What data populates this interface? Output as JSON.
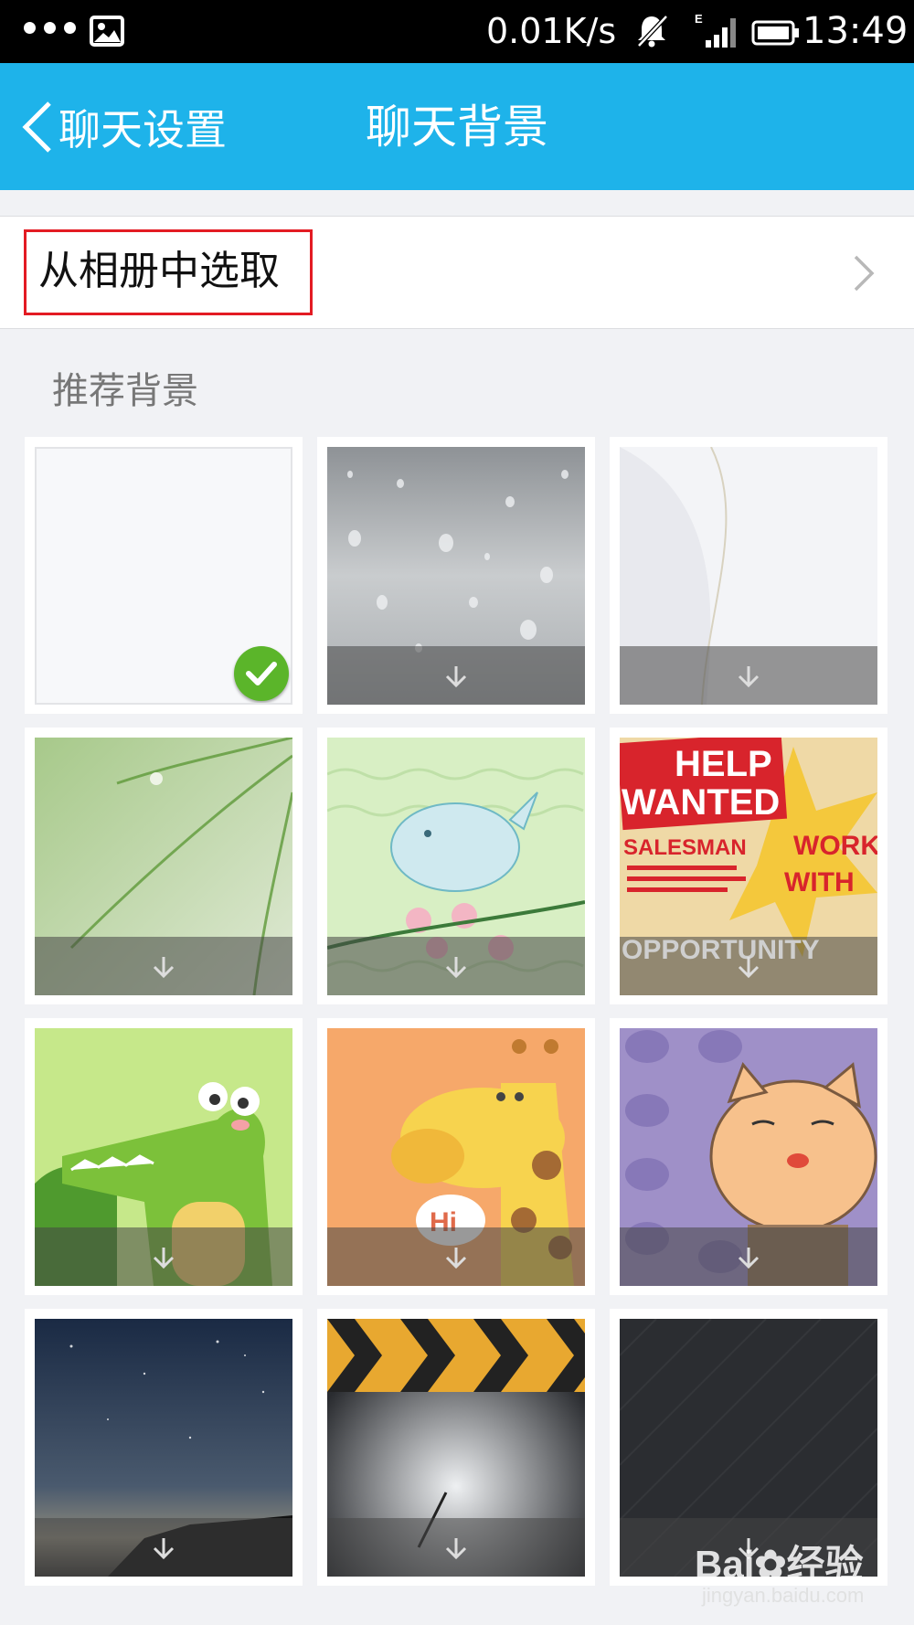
{
  "status_bar": {
    "speed": "0.01K/s",
    "time": "13:49",
    "network_type": "E",
    "icons": [
      "more-dots-icon",
      "image-notification-icon",
      "mute-icon",
      "signal-icon",
      "battery-icon"
    ]
  },
  "nav": {
    "back_label": "聊天设置",
    "title": "聊天背景",
    "color": "#1eb3ea"
  },
  "album": {
    "label": "从相册中选取"
  },
  "section": {
    "title": "推荐背景"
  },
  "backgrounds": [
    {
      "id": "blank",
      "selected": true,
      "downloadable": false
    },
    {
      "id": "rain-drops",
      "selected": false,
      "downloadable": true
    },
    {
      "id": "feather",
      "selected": false,
      "downloadable": true
    },
    {
      "id": "green-grass",
      "selected": false,
      "downloadable": true
    },
    {
      "id": "bird-flowers",
      "selected": false,
      "downloadable": true
    },
    {
      "id": "help-wanted",
      "selected": false,
      "downloadable": true
    },
    {
      "id": "crocodile",
      "selected": false,
      "downloadable": true
    },
    {
      "id": "giraffe",
      "selected": false,
      "downloadable": true
    },
    {
      "id": "cat-face",
      "selected": false,
      "downloadable": true
    },
    {
      "id": "night-sky",
      "selected": false,
      "downloadable": true
    },
    {
      "id": "chevron-stripes",
      "selected": false,
      "downloadable": true
    },
    {
      "id": "dark-texture",
      "selected": false,
      "downloadable": true
    }
  ],
  "poster_text": {
    "line1": "HELP",
    "line2": "WANTED",
    "line3": "SALESMAN",
    "line4": "WORK",
    "line5": "WITH",
    "line6": "OPPORTUNITY"
  },
  "giraffe_bubble": "Hi",
  "watermark": {
    "brand": "Bai",
    "brand_cn": "经验",
    "url": "jingyan.baidu.com"
  }
}
